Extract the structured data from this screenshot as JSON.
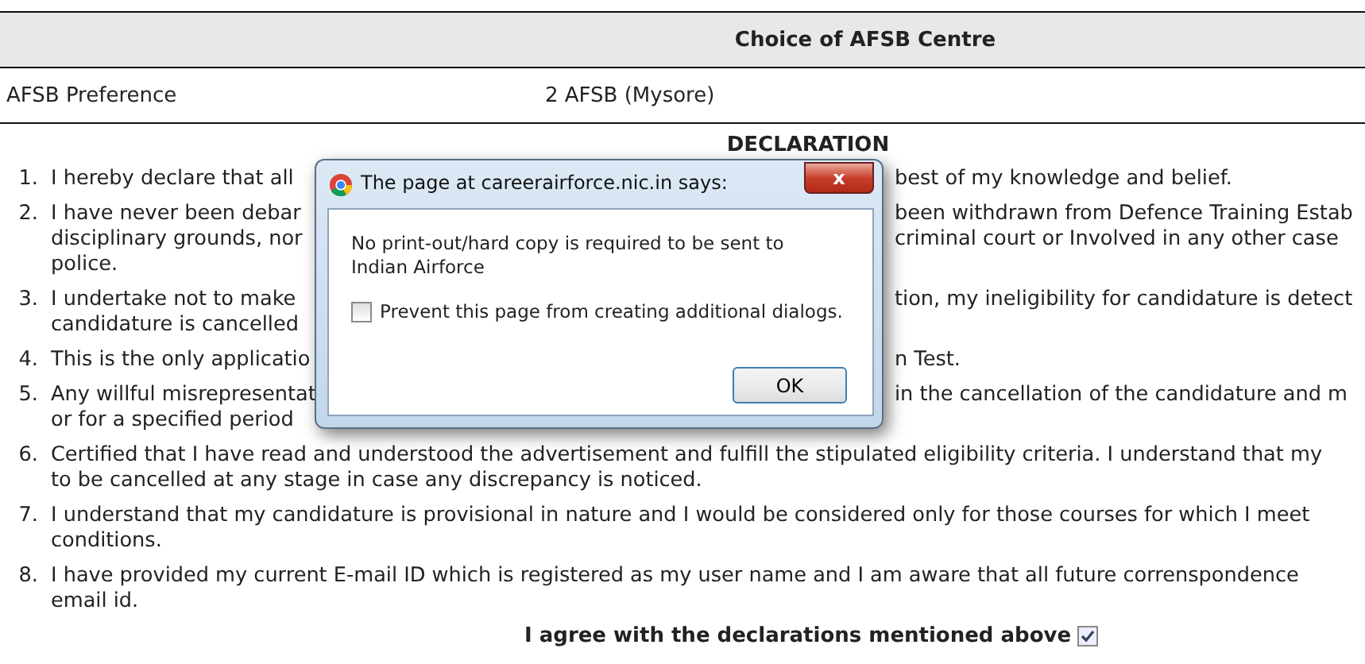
{
  "table": {
    "header": "Choice of AFSB Centre",
    "rows": [
      {
        "label": "AFSB Preference",
        "value": "2 AFSB (Mysore)"
      }
    ]
  },
  "declaration": {
    "title": "DECLARATION",
    "items": [
      {
        "number": "1.",
        "lines": [
          {
            "left": "I hereby declare that all",
            "right": "best of my knowledge and belief."
          }
        ]
      },
      {
        "number": "2.",
        "lines": [
          {
            "left": "I have never been debar",
            "right": "been withdrawn from Defence Training Estab"
          },
          {
            "left": "disciplinary grounds, nor",
            "right": "criminal court or Involved in any other case"
          },
          {
            "left": "police."
          }
        ]
      },
      {
        "number": "3.",
        "lines": [
          {
            "left": "I undertake not to make",
            "right": "tion, my ineligibility for candidature is detect"
          },
          {
            "left": "candidature is cancelled"
          }
        ]
      },
      {
        "number": "4.",
        "lines": [
          {
            "left": "This is the only applicatio",
            "right": "n Test."
          }
        ]
      },
      {
        "number": "5.",
        "lines": [
          {
            "left": "Any willful misrepresentat",
            "right": "in the cancellation of the candidature and m"
          },
          {
            "left": "or for a specified period"
          }
        ]
      },
      {
        "number": "6.",
        "lines": [
          {
            "left": "Certified that I have read and understood the advertisement and fulfill the stipulated eligibility criteria. I understand that my"
          },
          {
            "left": "to be cancelled at any stage in case any discrepancy is noticed."
          }
        ]
      },
      {
        "number": "7.",
        "lines": [
          {
            "left": "I understand that my candidature is provisional in nature and I would be considered only for those courses for which I meet"
          },
          {
            "left": "conditions."
          }
        ]
      },
      {
        "number": "8.",
        "lines": [
          {
            "left": "I have provided my current E-mail ID which is registered as my user name and I am aware that all future correnspondence"
          },
          {
            "left": "email id."
          }
        ]
      }
    ],
    "agree": {
      "label": "I agree with the declarations mentioned above",
      "checked": true
    }
  },
  "dialog": {
    "title": "The page at careerairforce.nic.in says:",
    "close": "x",
    "message": "No print-out/hard copy is required to be sent to Indian Airforce",
    "option": {
      "label": "Prevent this page from creating additional dialogs.",
      "checked": false
    },
    "button": "OK"
  }
}
